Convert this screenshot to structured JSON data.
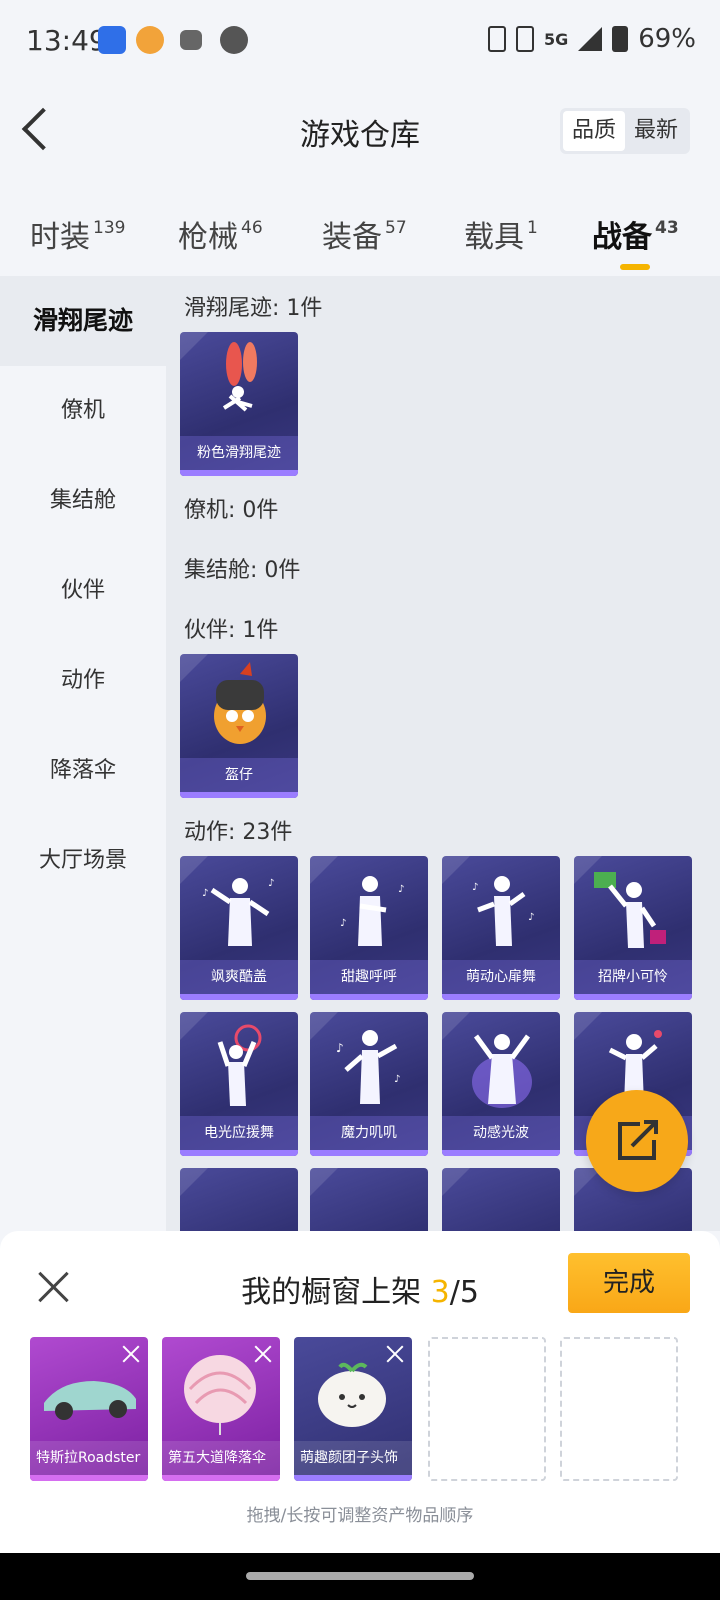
{
  "status_bar": {
    "time": "13:49",
    "network": "5G",
    "battery": "69%"
  },
  "header": {
    "title": "游戏仓库",
    "sort_options": [
      "品质",
      "最新"
    ],
    "sort_selected": "品质"
  },
  "tabs": [
    {
      "label": "时装",
      "count": "139"
    },
    {
      "label": "枪械",
      "count": "46"
    },
    {
      "label": "装备",
      "count": "57"
    },
    {
      "label": "载具",
      "count": "1"
    },
    {
      "label": "战备",
      "count": "43",
      "active": true
    }
  ],
  "sidebar": {
    "items": [
      "滑翔尾迹",
      "僚机",
      "集结舱",
      "伙伴",
      "动作",
      "降落伞",
      "大厅场景"
    ],
    "active": "滑翔尾迹"
  },
  "sections": [
    {
      "title": "滑翔尾迹: 1件",
      "items": [
        "粉色滑翔尾迹"
      ]
    },
    {
      "title": "僚机: 0件",
      "items": []
    },
    {
      "title": "集结舱: 0件",
      "items": []
    },
    {
      "title": "伙伴: 1件",
      "items": [
        "盔仔"
      ]
    },
    {
      "title": "动作: 23件",
      "items": [
        "飒爽酷盖",
        "甜趣呼呼",
        "萌动心扉舞",
        "招牌小可怜",
        "电光应援舞",
        "魔力叽叽",
        "动感光波",
        ""
      ]
    }
  ],
  "showcase": {
    "title_prefix": "我的橱窗上架 ",
    "count": "3",
    "total": "/5",
    "done_label": "完成",
    "slots": [
      "特斯拉Roadster",
      "第五大道降落伞",
      "萌趣颜团子头饰"
    ],
    "hint": "拖拽/长按可调整资产物品顺序"
  },
  "colors": {
    "accent": "#f5b400",
    "fab": "#f7a819",
    "card_purple": "#3a3880",
    "slot_magenta": "#a23ad0"
  }
}
